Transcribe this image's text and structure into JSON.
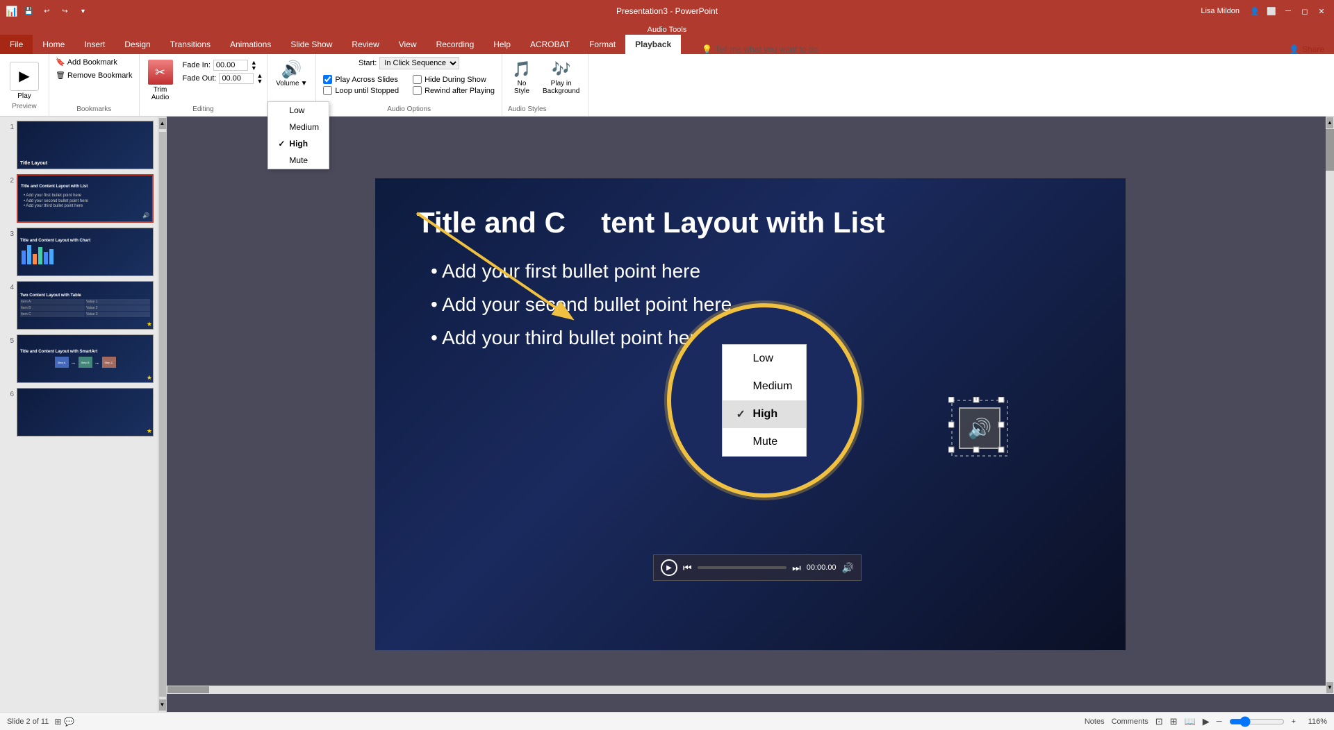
{
  "titlebar": {
    "app_title": "Presentation3 - PowerPoint",
    "user": "Lisa Mildon",
    "quick_access": [
      "undo",
      "redo",
      "customize"
    ]
  },
  "audio_tools_label": "Audio Tools",
  "ribbon": {
    "tabs": [
      "File",
      "Home",
      "Insert",
      "Design",
      "Transitions",
      "Animations",
      "Slide Show",
      "Review",
      "View",
      "Recording",
      "Help",
      "ACROBAT",
      "Format",
      "Playback"
    ],
    "active_tab": "Playback",
    "groups": {
      "preview": {
        "label": "Preview",
        "play_btn": "▶"
      },
      "bookmarks": {
        "label": "Bookmarks",
        "add": "Add Bookmark",
        "remove": "Remove Bookmark"
      },
      "editing": {
        "label": "Editing",
        "trim_label": "Trim\nAudio",
        "fade_in_label": "Fade In:",
        "fade_in_value": "00.00",
        "fade_out_label": "Fade Out:",
        "fade_out_value": "00.00"
      },
      "audio_options": {
        "label": "Audio Options",
        "start_label": "Start:",
        "start_value": "In Click Sequence",
        "play_across_slides": "Play Across Slides",
        "loop_until_stopped": "Loop until Stopped",
        "hide_during_show": "Hide During Show",
        "rewind_after_playing": "Rewind after Playing"
      },
      "volume": {
        "label": "Volume",
        "options": [
          "Low",
          "Medium",
          "High",
          "Mute"
        ],
        "selected": "High"
      },
      "audio_styles": {
        "label": "Audio Styles",
        "no_style": "No\nStyle",
        "play_in_background": "Play in\nBackground"
      }
    }
  },
  "tell_me": "Tell me what you want to do",
  "share_label": "Share",
  "slides": [
    {
      "number": "1",
      "title": "Title Layout",
      "active": false,
      "star": false
    },
    {
      "number": "2",
      "title": "Title and Content Layout with List",
      "active": true,
      "star": false
    },
    {
      "number": "3",
      "title": "Title and Content Layout with Chart",
      "active": false,
      "star": false
    },
    {
      "number": "4",
      "title": "Two Content Layout with Table",
      "active": false,
      "star": true
    },
    {
      "number": "5",
      "title": "Title and Content Layout with SmartArt",
      "active": false,
      "star": true
    },
    {
      "number": "6",
      "title": "",
      "active": false,
      "star": true
    }
  ],
  "slide": {
    "title": "Title and Content Layout with List",
    "bullets": [
      "Add your first bullet point here",
      "Add your second bullet point here",
      "Add your third bullet point here"
    ]
  },
  "audio_playbar": {
    "time": "00:00.00",
    "volume_icon": "🔊"
  },
  "volume_dropdown": {
    "items": [
      "Low",
      "Medium",
      "High",
      "Mute"
    ],
    "selected": "High"
  },
  "status_bar": {
    "slide_info": "Slide 2 of 11",
    "notes_label": "Notes",
    "comments_label": "Comments",
    "zoom": "116%"
  }
}
